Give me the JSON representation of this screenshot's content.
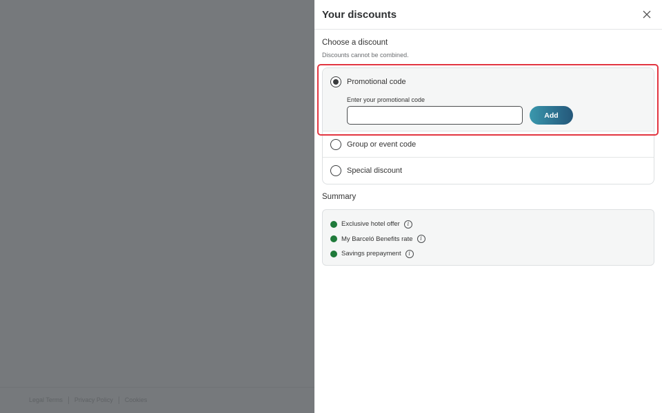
{
  "footer": {
    "links": [
      "Legal Terms",
      "Privacy Policy",
      "Cookies"
    ]
  },
  "panel": {
    "title": "Your discounts",
    "close_icon": "close-icon",
    "choose_title": "Choose a discount",
    "note": "Discounts cannot be combined.",
    "options": [
      {
        "label": "Promotional code",
        "selected": true
      },
      {
        "label": "Group or event code",
        "selected": false
      },
      {
        "label": "Special discount",
        "selected": false
      }
    ],
    "promo": {
      "hint": "Enter your promotional code",
      "input_value": "",
      "add_label": "Add"
    },
    "summary": {
      "title": "Summary",
      "items": [
        {
          "label": "Exclusive hotel offer"
        },
        {
          "label": "My Barceló Benefits rate"
        },
        {
          "label": "Savings prepayment"
        }
      ]
    }
  },
  "colors": {
    "overlay": "#76797c",
    "accent_start": "#3a98ad",
    "accent_end": "#25587a",
    "check_green": "#1f7a3a",
    "highlight_red": "#e2343f"
  }
}
